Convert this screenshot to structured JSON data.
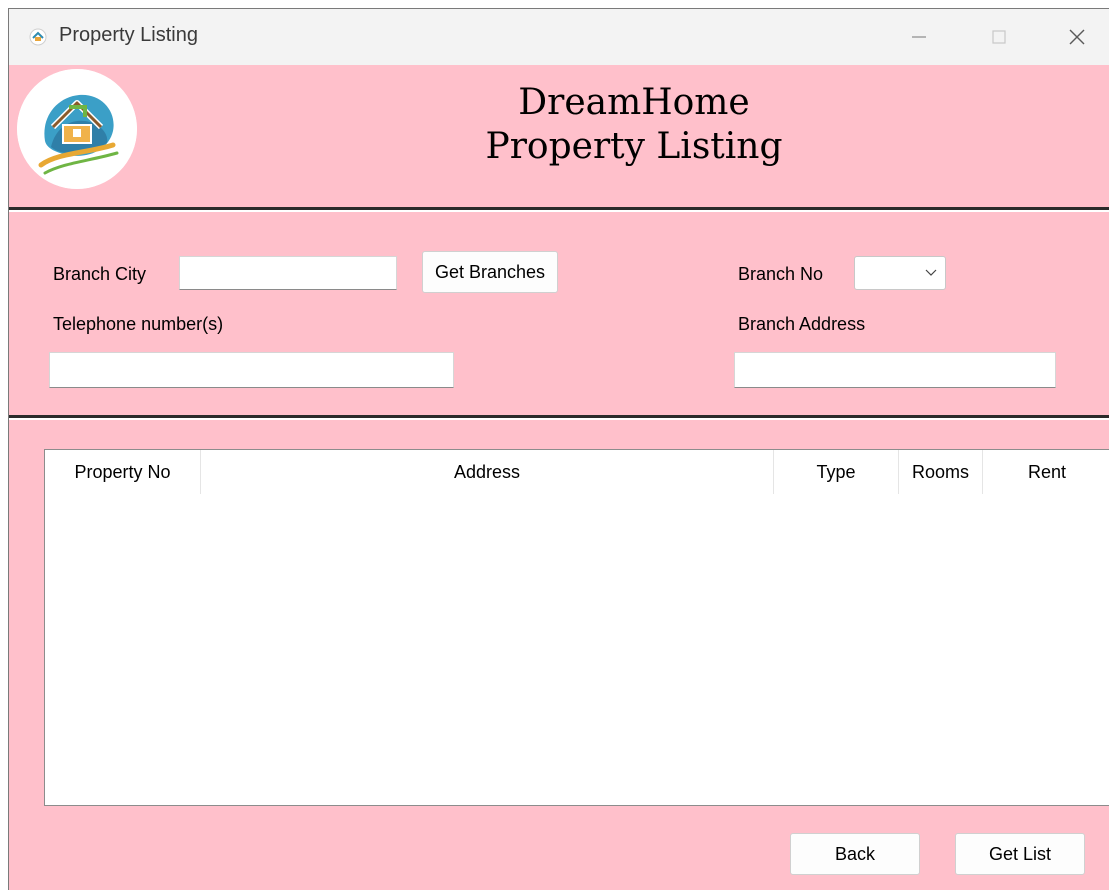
{
  "window": {
    "title": "Property Listing",
    "controls": [
      "minimize-icon",
      "maximize-icon",
      "close-icon"
    ]
  },
  "header": {
    "brand": "DreamHome",
    "subtitle": "Property Listing",
    "logo_icon": "house-logo-icon"
  },
  "branch_form": {
    "city_label": "Branch City",
    "city_value": "",
    "get_branches_label": "Get Branches",
    "branch_no_label": "Branch No",
    "branch_no_value": "",
    "telephone_label": "Telephone number(s)",
    "telephone_value": "",
    "address_label": "Branch Address",
    "address_value": ""
  },
  "table": {
    "columns": [
      "Property No",
      "Address",
      "Type",
      "Rooms",
      "Rent"
    ],
    "rows": []
  },
  "footer": {
    "back_label": "Back",
    "get_list_label": "Get List"
  },
  "colors": {
    "background": "#ffc0cb",
    "titlebar": "#f3f3f3"
  }
}
